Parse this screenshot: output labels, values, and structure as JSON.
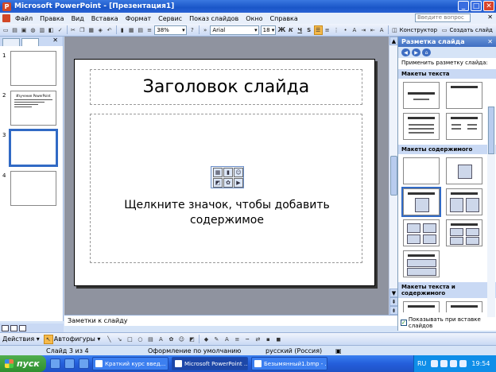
{
  "window": {
    "title": "Microsoft PowerPoint - [Презентация1]",
    "app_icon": "P",
    "btn_min": "_",
    "btn_max": "□",
    "btn_close": "✕"
  },
  "menu": {
    "items": [
      "Файл",
      "Правка",
      "Вид",
      "Вставка",
      "Формат",
      "Сервис",
      "Показ слайдов",
      "Окно",
      "Справка"
    ],
    "help_placeholder": "Введите вопрос",
    "close_doc": "✕"
  },
  "toolbar": {
    "zoom": "38%",
    "font": "Arial",
    "size": "18",
    "bold": "Ж",
    "italic": "К",
    "underline": "Ч",
    "shadow": "S",
    "designer": "Конструктор",
    "new_slide": "Создать слайд"
  },
  "outline": {
    "close": "✕",
    "slides": [
      {
        "num": "1",
        "title": ""
      },
      {
        "num": "2",
        "title": "Изучение PowerPoint"
      },
      {
        "num": "3",
        "title": ""
      },
      {
        "num": "4",
        "title": ""
      }
    ]
  },
  "slide": {
    "title": "Заголовок слайда",
    "body_line1": "Щелкните значок, чтобы добавить",
    "body_line2": "содержимое"
  },
  "notes": {
    "placeholder": "Заметки к слайду"
  },
  "taskpane": {
    "title": "Разметка слайда",
    "close": "✕",
    "apply_label": "Применить разметку слайда:",
    "section_text": "Макеты текста",
    "section_content": "Макеты содержимого",
    "section_text_content": "Макеты текста и содержимого",
    "show_on_insert": "Показывать при вставке слайдов",
    "show_on_insert_checked": "✓"
  },
  "drawbar": {
    "actions": "Действия ▾",
    "autoshapes": "Автофигуры ▾"
  },
  "status": {
    "slide_pos": "Слайд 3 из 4",
    "design": "Оформление по умолчанию",
    "language": "русский (Россия)"
  },
  "taskbar": {
    "start": "пуск",
    "tasks": [
      "Краткий курс введ...",
      "Microsoft PowerPoint ...",
      "Безымянный1.bmp - ..."
    ],
    "lang": "RU",
    "clock": "19:54"
  }
}
